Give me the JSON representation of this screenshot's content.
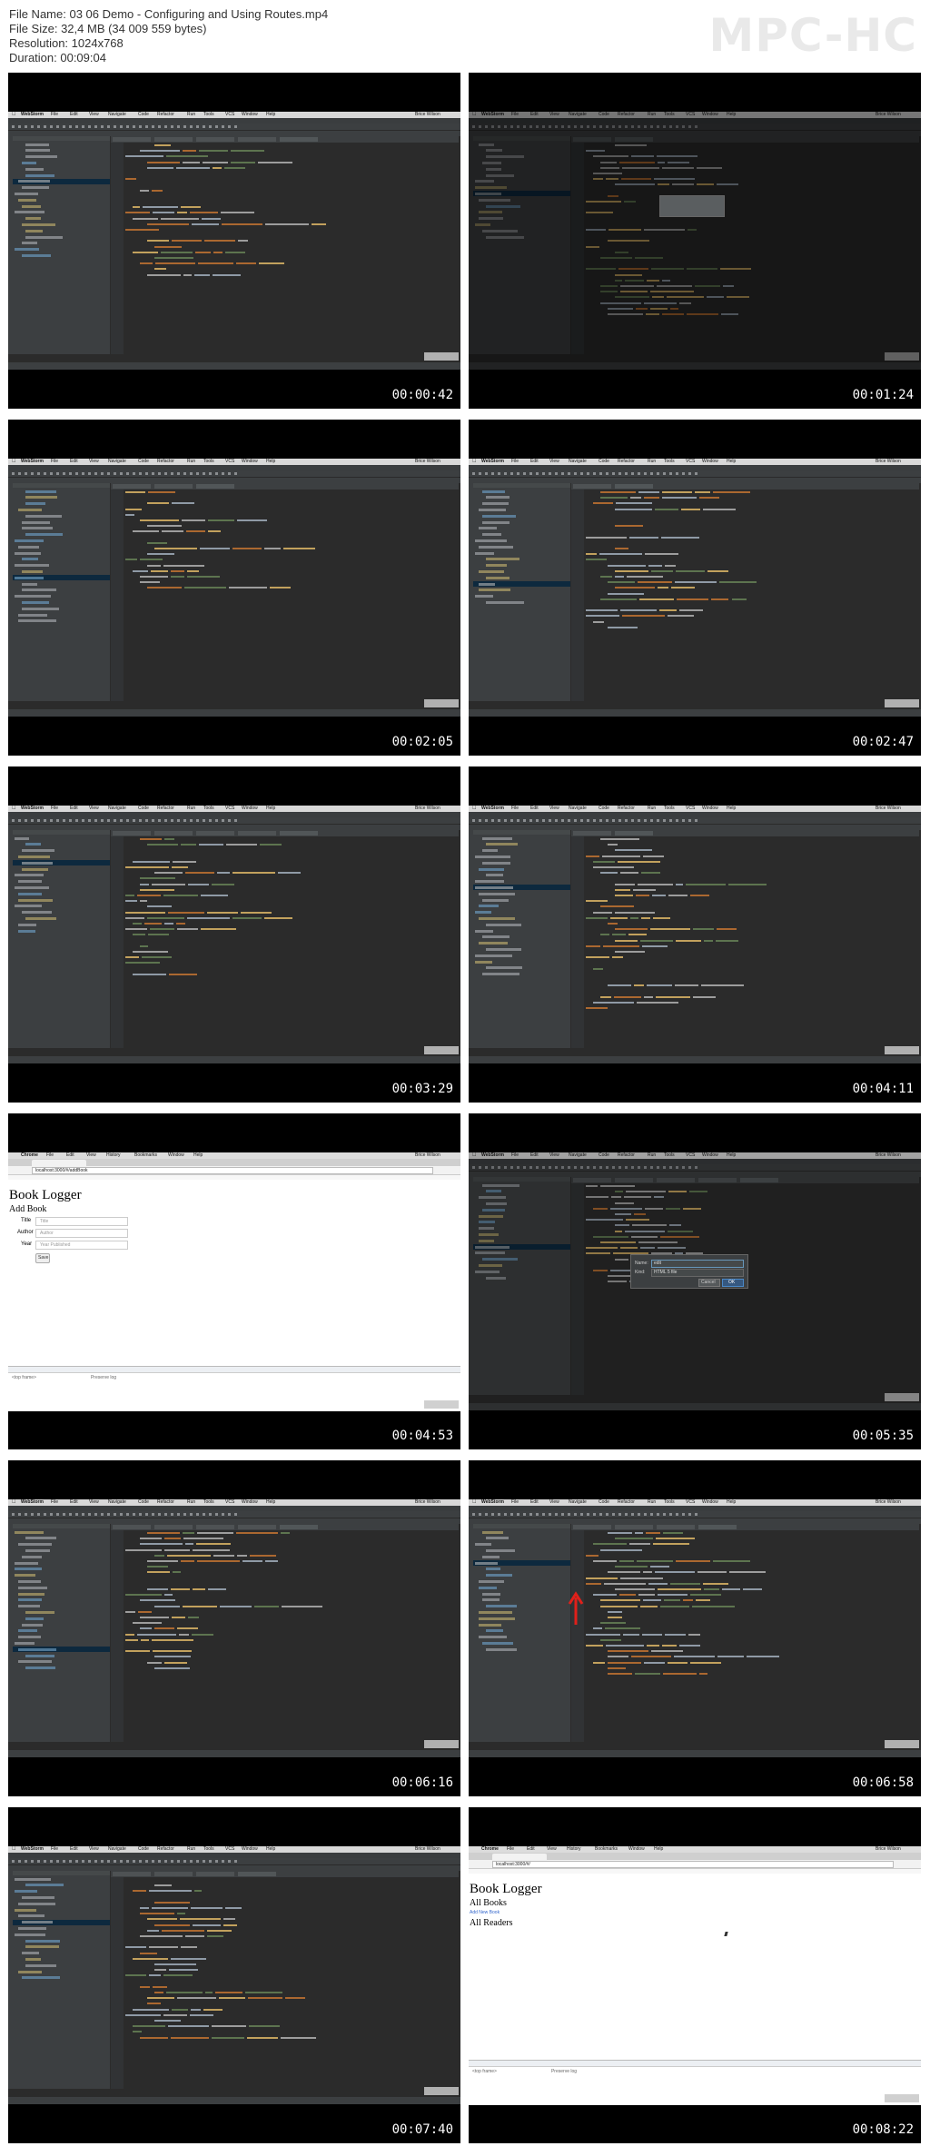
{
  "header": {
    "file_name": "File Name: 03 06 Demo - Configuring and Using Routes.mp4",
    "file_size": "File Size: 32,4 MB (34 009 559 bytes)",
    "resolution": "Resolution: 1024x768",
    "duration": "Duration: 00:09:04",
    "brand": "MPC-HC"
  },
  "ide_menu": [
    "WebStorm",
    "File",
    "Edit",
    "View",
    "Navigate",
    "Code",
    "Refactor",
    "Run",
    "Tools",
    "VCS",
    "Window",
    "Help"
  ],
  "ide_user": "Brice Wilson",
  "browser_menu": [
    "Chrome",
    "File",
    "Edit",
    "View",
    "History",
    "Bookmarks",
    "Window",
    "Help"
  ],
  "frames": [
    {
      "time": "00:00:42",
      "kind": "ide"
    },
    {
      "time": "00:01:24",
      "kind": "ide-dim"
    },
    {
      "time": "00:02:05",
      "kind": "ide"
    },
    {
      "time": "00:02:47",
      "kind": "ide"
    },
    {
      "time": "00:03:29",
      "kind": "ide"
    },
    {
      "time": "00:04:11",
      "kind": "ide"
    },
    {
      "time": "00:04:53",
      "kind": "browser-add"
    },
    {
      "time": "00:05:35",
      "kind": "ide-dialog"
    },
    {
      "time": "00:06:16",
      "kind": "ide"
    },
    {
      "time": "00:06:58",
      "kind": "ide-arrow"
    },
    {
      "time": "00:07:40",
      "kind": "ide"
    },
    {
      "time": "00:08:22",
      "kind": "browser-list"
    }
  ],
  "browser_add": {
    "url": "localhost:3000/#/addBook",
    "title": "Book Logger",
    "subtitle": "Add Book",
    "fields": [
      {
        "label": "Title",
        "placeholder": "Title"
      },
      {
        "label": "Author",
        "placeholder": "Author"
      },
      {
        "label": "Year",
        "placeholder": "Year Published"
      }
    ],
    "save": "Save",
    "console_filter": "Regex",
    "console_frame": "<top frame>",
    "console_preserve": "Preserve log"
  },
  "browser_list": {
    "url": "localhost:3000/#/",
    "title": "Book Logger",
    "section1": "All Books",
    "add_link": "Add New Book",
    "section2": "All Readers",
    "console_frame": "<top frame>",
    "console_preserve": "Preserve log"
  },
  "dialog": {
    "name_label": "Name:",
    "name_value": "edit",
    "kind_label": "Kind:",
    "kind_value": "HTML 5 file",
    "cancel": "Cancel",
    "ok": "OK"
  },
  "colors": {
    "ide_bg": "#2b2b2b",
    "keyword": "#cc7832",
    "string": "#6a8759",
    "tag": "#e8bf6a",
    "attr": "#bababa",
    "plain": "#a9b7c6",
    "red_arrow": "#e0201a"
  }
}
